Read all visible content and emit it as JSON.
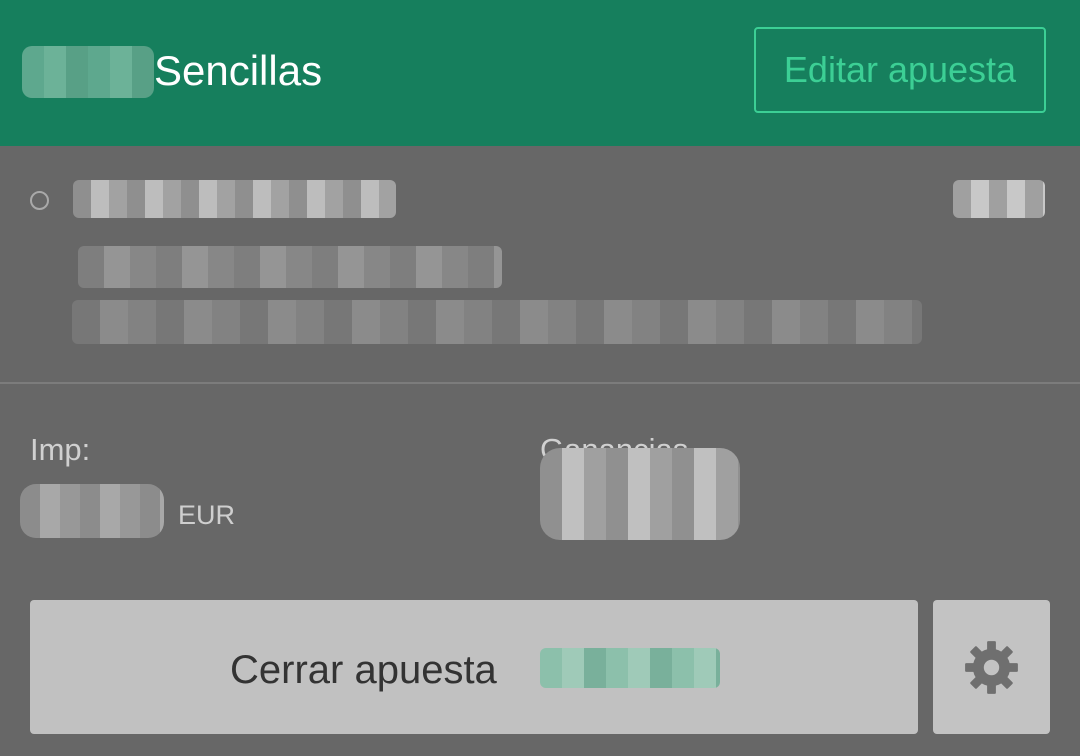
{
  "header": {
    "title": "Sencillas",
    "edit_button": "Editar apuesta"
  },
  "stake": {
    "imp_label": "Imp:",
    "currency": "EUR",
    "winnings_label": "Ganancias"
  },
  "footer": {
    "close_bet_label": "Cerrar apuesta",
    "settings_icon": "gear-icon"
  },
  "colors": {
    "header_bg": "#167f5d",
    "accent": "#3ccf95",
    "overlay_bg": "#676767"
  }
}
